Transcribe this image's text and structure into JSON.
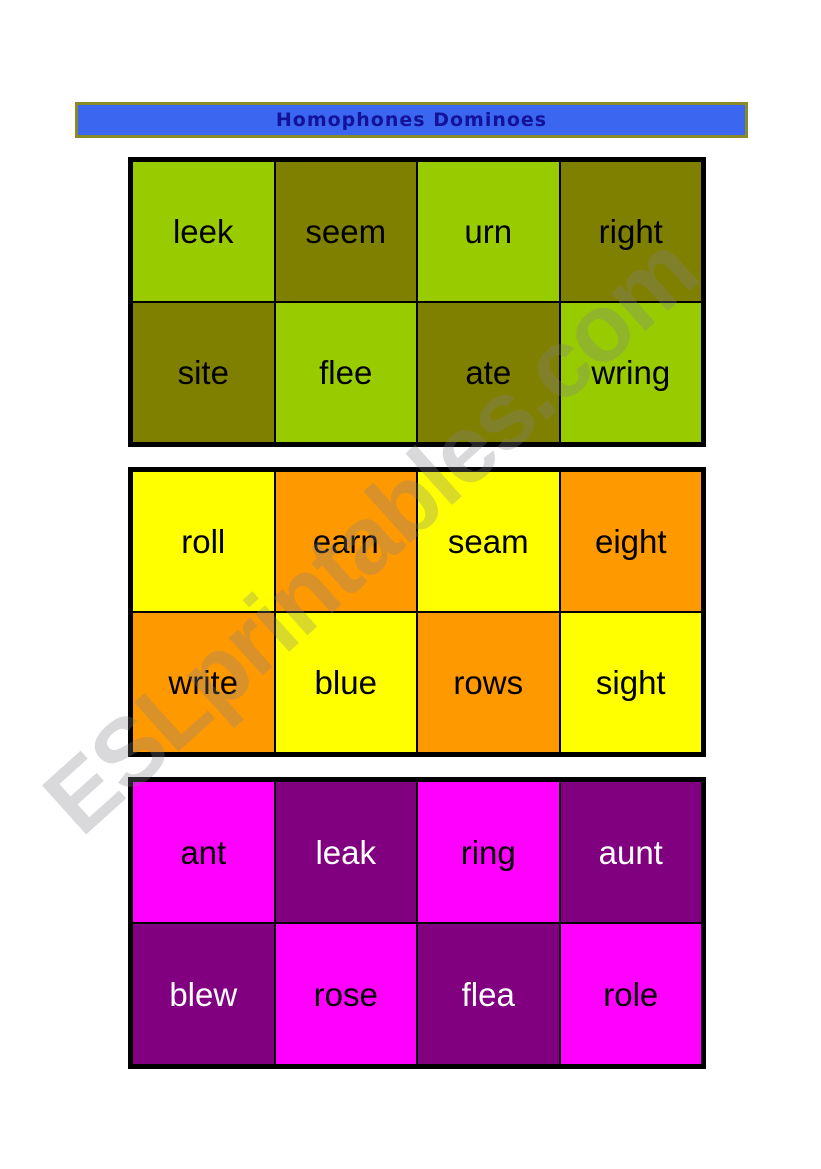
{
  "title": {
    "text": "Homophones Dominoes",
    "banner_bg": "#3b66ef",
    "banner_border": "#8a8a28",
    "text_color": "#12129a"
  },
  "watermark": {
    "text": "ESLprintables.com"
  },
  "palette": {
    "light_green": "#99cc00",
    "olive": "#808000",
    "yellow": "#ffff00",
    "orange": "#ff9900",
    "magenta": "#ff00ff",
    "purple": "#800080",
    "border": "#000000",
    "ink_black": "#000000",
    "ink_white": "#ffffff"
  },
  "domino_sets": [
    {
      "id": "green",
      "cells": [
        {
          "word": "leek",
          "fill": "light_green",
          "ink": "black"
        },
        {
          "word": "seem",
          "fill": "olive",
          "ink": "black"
        },
        {
          "word": "urn",
          "fill": "light_green",
          "ink": "black"
        },
        {
          "word": "right",
          "fill": "olive",
          "ink": "black"
        },
        {
          "word": "site",
          "fill": "olive",
          "ink": "black"
        },
        {
          "word": "flee",
          "fill": "light_green",
          "ink": "black"
        },
        {
          "word": "ate",
          "fill": "olive",
          "ink": "black"
        },
        {
          "word": "wring",
          "fill": "light_green",
          "ink": "black"
        }
      ]
    },
    {
      "id": "orange",
      "cells": [
        {
          "word": "roll",
          "fill": "yellow",
          "ink": "black"
        },
        {
          "word": "earn",
          "fill": "orange",
          "ink": "black"
        },
        {
          "word": "seam",
          "fill": "yellow",
          "ink": "black"
        },
        {
          "word": "eight",
          "fill": "orange",
          "ink": "black"
        },
        {
          "word": "write",
          "fill": "orange",
          "ink": "black"
        },
        {
          "word": "blue",
          "fill": "yellow",
          "ink": "black"
        },
        {
          "word": "rows",
          "fill": "orange",
          "ink": "black"
        },
        {
          "word": "sight",
          "fill": "yellow",
          "ink": "black"
        }
      ]
    },
    {
      "id": "purple",
      "cells": [
        {
          "word": "ant",
          "fill": "magenta",
          "ink": "black"
        },
        {
          "word": "leak",
          "fill": "purple",
          "ink": "white"
        },
        {
          "word": "ring",
          "fill": "magenta",
          "ink": "black"
        },
        {
          "word": "aunt",
          "fill": "purple",
          "ink": "white"
        },
        {
          "word": "blew",
          "fill": "purple",
          "ink": "white"
        },
        {
          "word": "rose",
          "fill": "magenta",
          "ink": "black"
        },
        {
          "word": "flea",
          "fill": "purple",
          "ink": "white"
        },
        {
          "word": "role",
          "fill": "magenta",
          "ink": "black"
        }
      ]
    }
  ]
}
